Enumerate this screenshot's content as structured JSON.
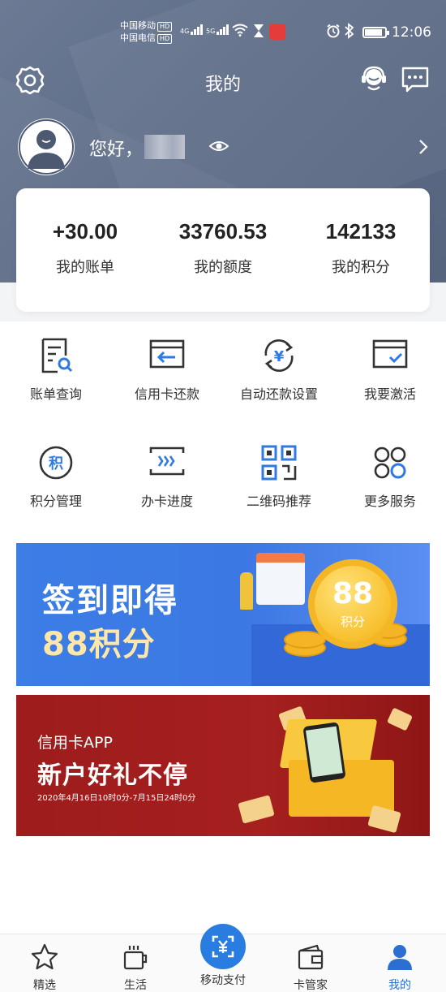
{
  "status_bar": {
    "carrier_1": "中国移动",
    "carrier_2": "中国电信",
    "hd_badge": "HD",
    "net_1": "4G",
    "net_2": "5G",
    "time": "12:06"
  },
  "header": {
    "title": "我的",
    "greeting": "您好，"
  },
  "stats": [
    {
      "value": "+30.00",
      "label": "我的账单"
    },
    {
      "value": "33760.53",
      "label": "我的额度"
    },
    {
      "value": "142133",
      "label": "我的积分"
    }
  ],
  "services": [
    {
      "label": "账单查询",
      "icon": "bill-query-icon"
    },
    {
      "label": "信用卡还款",
      "icon": "card-repay-icon"
    },
    {
      "label": "自动还款设置",
      "icon": "auto-repay-icon"
    },
    {
      "label": "我要激活",
      "icon": "activate-card-icon"
    },
    {
      "label": "积分管理",
      "icon": "points-icon"
    },
    {
      "label": "办卡进度",
      "icon": "progress-icon"
    },
    {
      "label": "二维码推荐",
      "icon": "qr-code-icon"
    },
    {
      "label": "更多服务",
      "icon": "more-services-icon"
    }
  ],
  "icon_glyphs": {
    "auto_repay": "¥",
    "points": "积"
  },
  "banner_checkin": {
    "title": "签到即得",
    "subtitle": "88积分",
    "coin_number": "88",
    "coin_unit": "积分"
  },
  "banner_newuser": {
    "kicker": "信用卡APP",
    "title": "新户好礼不停",
    "date_range": "2020年4月16日10时0分-7月15日24时0分"
  },
  "tabbar": [
    {
      "label": "精选",
      "icon": "star-icon",
      "active": false
    },
    {
      "label": "生活",
      "icon": "coffee-cup-icon",
      "active": false
    },
    {
      "label": "移动支付",
      "icon": "scan-pay-icon",
      "active": false
    },
    {
      "label": "卡管家",
      "icon": "wallet-icon",
      "active": false
    },
    {
      "label": "我的",
      "icon": "person-icon",
      "active": true
    }
  ],
  "colors": {
    "header_bg": "#5f6e89",
    "accent_blue": "#2a6fd1",
    "icon_blue": "#2f7be0",
    "banner_blue": "#3c7de6",
    "banner_red": "#9e1c1c"
  }
}
